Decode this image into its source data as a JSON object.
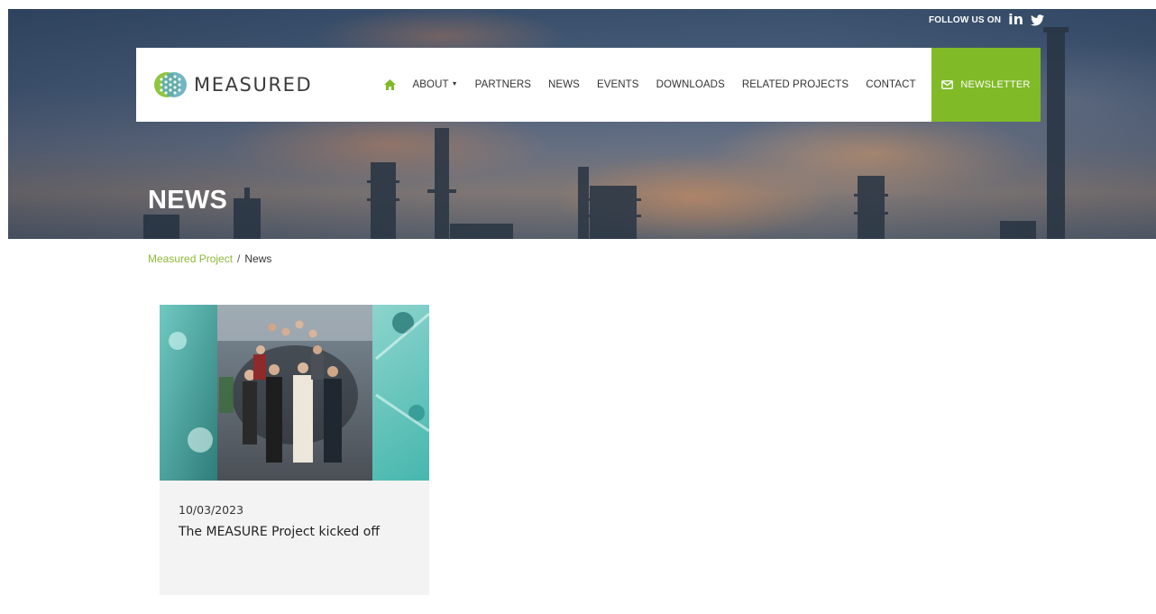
{
  "social": {
    "label": "FOLLOW US ON",
    "linkedin_label": "in",
    "icons": [
      "linkedin-icon",
      "twitter-icon"
    ]
  },
  "header": {
    "logo_text": "MEASURED",
    "nav": {
      "home_icon": "home-icon",
      "items": [
        {
          "label": "ABOUT",
          "has_dropdown": true
        },
        {
          "label": "PARTNERS"
        },
        {
          "label": "NEWS"
        },
        {
          "label": "EVENTS"
        },
        {
          "label": "DOWNLOADS"
        },
        {
          "label": "RELATED PROJECTS"
        },
        {
          "label": "CONTACT"
        }
      ],
      "search_icon": "search-icon"
    },
    "newsletter": {
      "label": "NEWSLETTER",
      "icon": "envelope-icon"
    }
  },
  "hero": {
    "title": "NEWS"
  },
  "breadcrumb": {
    "home": "Measured Project",
    "separator": "/",
    "current": "News"
  },
  "news": [
    {
      "date": "10/03/2023",
      "title": "The MEASURE Project kicked off"
    }
  ],
  "colors": {
    "accent": "#80ba27",
    "breadcrumb_link": "#8dbb3a",
    "card_bg": "#f3f3f3"
  }
}
